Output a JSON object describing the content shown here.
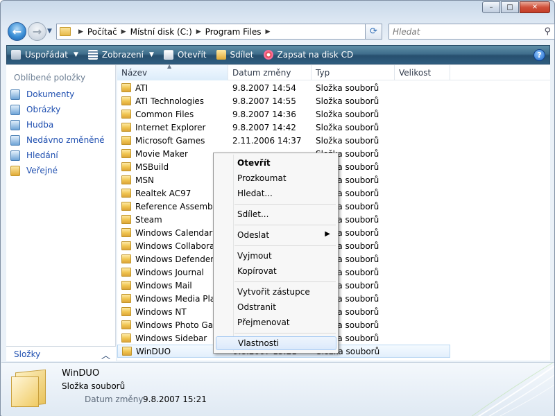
{
  "window": {
    "minimize_glyph": "–",
    "maximize_glyph": "□",
    "close_glyph": "✕"
  },
  "address": {
    "breadcrumbs": [
      "Počítač",
      "Místní disk (C:)",
      "Program Files"
    ],
    "separator": "▶",
    "search_placeholder": "Hledat"
  },
  "toolbar": {
    "organize": "Uspořádat",
    "views": "Zobrazení",
    "open": "Otevřít",
    "share": "Sdílet",
    "burn": "Zapsat na disk CD",
    "help": "?"
  },
  "nav_pane": {
    "header": "Oblíbené položky",
    "items": [
      "Dokumenty",
      "Obrázky",
      "Hudba",
      "Nedávno změněné",
      "Hledání",
      "Veřejné"
    ],
    "folders_label": "Složky"
  },
  "columns": {
    "name": "Název",
    "date": "Datum změny",
    "type": "Typ",
    "size": "Velikost"
  },
  "files": [
    {
      "name": "ATI",
      "date": "9.8.2007 14:54",
      "type": "Složka souborů"
    },
    {
      "name": "ATI Technologies",
      "date": "9.8.2007 14:55",
      "type": "Složka souborů"
    },
    {
      "name": "Common Files",
      "date": "9.8.2007 14:36",
      "type": "Složka souborů"
    },
    {
      "name": "Internet Explorer",
      "date": "9.8.2007 14:42",
      "type": "Složka souborů"
    },
    {
      "name": "Microsoft Games",
      "date": "2.11.2006 14:37",
      "type": "Složka souborů"
    },
    {
      "name": "Movie Maker",
      "date": "",
      "type": "Složka souborů"
    },
    {
      "name": "MSBuild",
      "date": "",
      "type": "Složka souborů"
    },
    {
      "name": "MSN",
      "date": "",
      "type": "Složka souborů"
    },
    {
      "name": "Realtek AC97",
      "date": "",
      "type": "Složka souborů"
    },
    {
      "name": "Reference Assemblies",
      "date": "",
      "type": "Složka souborů"
    },
    {
      "name": "Steam",
      "date": "",
      "type": "Složka souborů"
    },
    {
      "name": "Windows Calendar",
      "date": "",
      "type": "Složka souborů"
    },
    {
      "name": "Windows Collaboration",
      "date": "",
      "type": "Složka souborů"
    },
    {
      "name": "Windows Defender",
      "date": "",
      "type": "Složka souborů"
    },
    {
      "name": "Windows Journal",
      "date": "",
      "type": "Složka souborů"
    },
    {
      "name": "Windows Mail",
      "date": "",
      "type": "Složka souborů"
    },
    {
      "name": "Windows Media Player",
      "date": "",
      "type": "Složka souborů"
    },
    {
      "name": "Windows NT",
      "date": "",
      "type": "Složka souborů"
    },
    {
      "name": "Windows Photo Gallery",
      "date": "",
      "type": "Složka souborů"
    },
    {
      "name": "Windows Sidebar",
      "date": "",
      "type": "Složka souborů"
    },
    {
      "name": "WinDUO",
      "date": "9.8.2007 15:21",
      "type": "Složka souborů"
    }
  ],
  "context_menu": {
    "open": "Otevřít",
    "explore": "Prozkoumat",
    "search": "Hledat...",
    "share": "Sdílet...",
    "send_to": "Odeslat",
    "cut": "Vyjmout",
    "copy": "Kopírovat",
    "create_shortcut": "Vytvořit zástupce",
    "delete": "Odstranit",
    "rename": "Přejmenovat",
    "properties": "Vlastnosti"
  },
  "details": {
    "name": "WinDUO",
    "type": "Složka souborů",
    "date_label": "Datum změny:",
    "date_value": "9.8.2007 15:21"
  },
  "colors": {
    "link_blue": "#1f4fb0",
    "toolbar_dark": "#274f6e",
    "selection": "#e2effc"
  }
}
